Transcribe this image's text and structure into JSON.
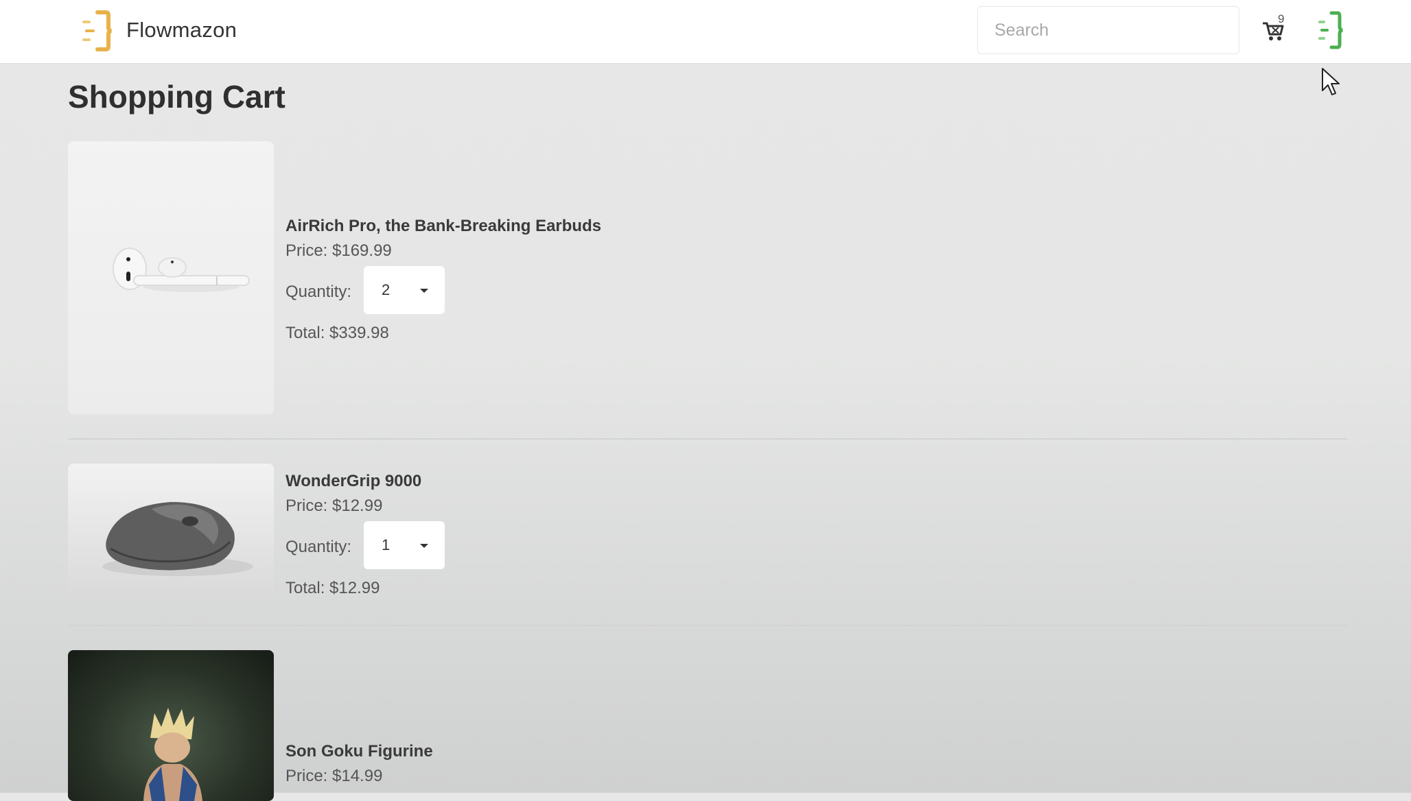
{
  "header": {
    "brand_name": "Flowmazon",
    "search_placeholder": "Search",
    "cart_count": "9"
  },
  "page": {
    "title": "Shopping Cart"
  },
  "cart": {
    "quantity_label": "Quantity:",
    "items": [
      {
        "name": "AirRich Pro, the Bank-Breaking Earbuds",
        "price": "Price: $169.99",
        "quantity": "2",
        "total": "Total: $339.98"
      },
      {
        "name": "WonderGrip 9000",
        "price": "Price: $12.99",
        "quantity": "1",
        "total": "Total: $12.99"
      },
      {
        "name": "Son Goku Figurine",
        "price": "Price: $14.99"
      }
    ]
  },
  "colors": {
    "brand_logo": "#e8b24a",
    "profile_logo": "#4caf50",
    "background": "#e6e7e6"
  }
}
